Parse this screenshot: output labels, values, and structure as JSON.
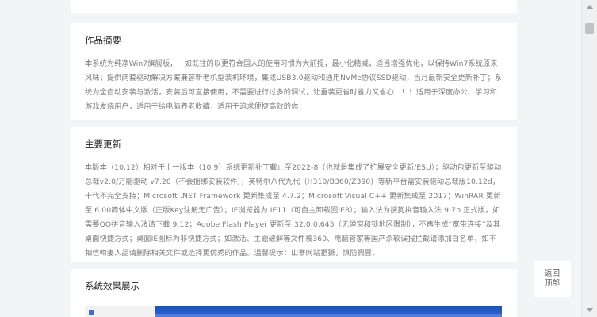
{
  "summary": {
    "title": "作品摘要",
    "text": "本系统为纯净Win7旗舰版，一如既往的以更符合国人的使用习惯为大前提，最小化精减，适当增强优化，以保持Win7系统原来风味；提供两套驱动解决方案兼容新老机型装机环境，集成USB3.0驱动和通用NVMe协议SSD驱动，当月最新安全更新补丁；系统为全自动安装与激活，安装后可直接使用，不需要进行过多的调试，让重装更省时省力又省心！！！适用于深度办公、学习和游戏发烧用户，适用于给电脑养老收藏，适用于追求便捷高效的你！"
  },
  "updates": {
    "title": "主要更新",
    "text": "本版本（10.12）相对于上一版本（10.9）系统更新补丁截止至2022-8（也就是集成了扩展安全更新/ESU）；驱动包更新至驱动总裁v2.0/万能驱动 v7.20（不会捆绑安装软件），英特尔八代九代（H310/B360/Z390）等新平台需安装驱动总裁版10.12d，十代不完全支持；Microsoft .NET Framework 更新集成至 4.7.2；Microsoft Visual C++ 更新集成至 2017；WinRAR 更新至 6.00简体中文版（正版Key注册无广告）；IE浏览器为 IE11（可自主卸载回IE8）；输入法为搜狗拼音输入法 9.7b 正式版，如需要QQ拼音输入法请下载 9.12；Adobe Flash Player 更新至 32.0.0.645（无弹窗和锁地区限制），不再生成“宽带连接”及其桌面快捷方式；桌面IE图标为非快捷方式；如激活、主题破解等文件被360、电脑管家等国产杀软误报拦截请添加白名单，如不相信吻妻人品请删除相关文件或选择更优秀的作品。温馨提示：山寨网站猖獗，慎防假冒。"
  },
  "effects": {
    "title": "系统效果展示"
  },
  "back_to_top": {
    "line1": "返回",
    "line2": "顶部"
  },
  "colors": {
    "page_background": "#f3f4f6",
    "card_background": "#ffffff",
    "title_text": "#222222",
    "body_text": "#7b7b7b",
    "preview_blue": "#2a6de0"
  }
}
